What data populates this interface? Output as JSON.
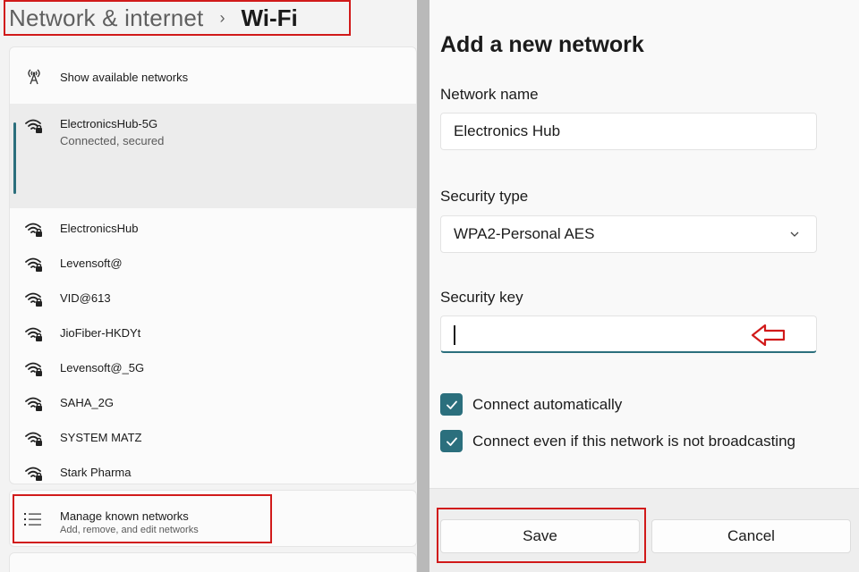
{
  "breadcrumb": {
    "parent": "Network & internet",
    "separator": "›",
    "current": "Wi-Fi"
  },
  "networks_panel": {
    "show_available_label": "Show available networks",
    "connected": {
      "name": "ElectronicsHub-5G",
      "status": "Connected, secured",
      "icon": "wifi-secured-icon"
    },
    "items": [
      {
        "name": "ElectronicsHub",
        "icon": "wifi-secured-icon"
      },
      {
        "name": "Levensoft@",
        "icon": "wifi-secured-icon"
      },
      {
        "name": "VID@613",
        "icon": "wifi-secured-icon"
      },
      {
        "name": "JioFiber-HKDYt",
        "icon": "wifi-secured-icon"
      },
      {
        "name": "Levensoft@_5G",
        "icon": "wifi-secured-icon"
      },
      {
        "name": "SAHA_2G",
        "icon": "wifi-secured-icon"
      },
      {
        "name": "SYSTEM MATZ",
        "icon": "wifi-secured-icon"
      },
      {
        "name": "Stark Pharma",
        "icon": "wifi-secured-icon"
      }
    ]
  },
  "manage": {
    "title": "Manage known networks",
    "description": "Add, remove, and edit networks"
  },
  "dialog": {
    "title": "Add a new network",
    "network_name_label": "Network name",
    "network_name_value": "Electronics Hub",
    "security_type_label": "Security type",
    "security_type_value": "WPA2-Personal AES",
    "security_key_label": "Security key",
    "security_key_value": "",
    "connect_automatically_label": "Connect automatically",
    "connect_automatically_checked": true,
    "connect_broadcasting_label": "Connect even if this network is not broadcasting",
    "connect_broadcasting_checked": true,
    "save_label": "Save",
    "cancel_label": "Cancel"
  },
  "colors": {
    "accent": "#2b6f7d",
    "highlight_red": "#d11a1a"
  }
}
